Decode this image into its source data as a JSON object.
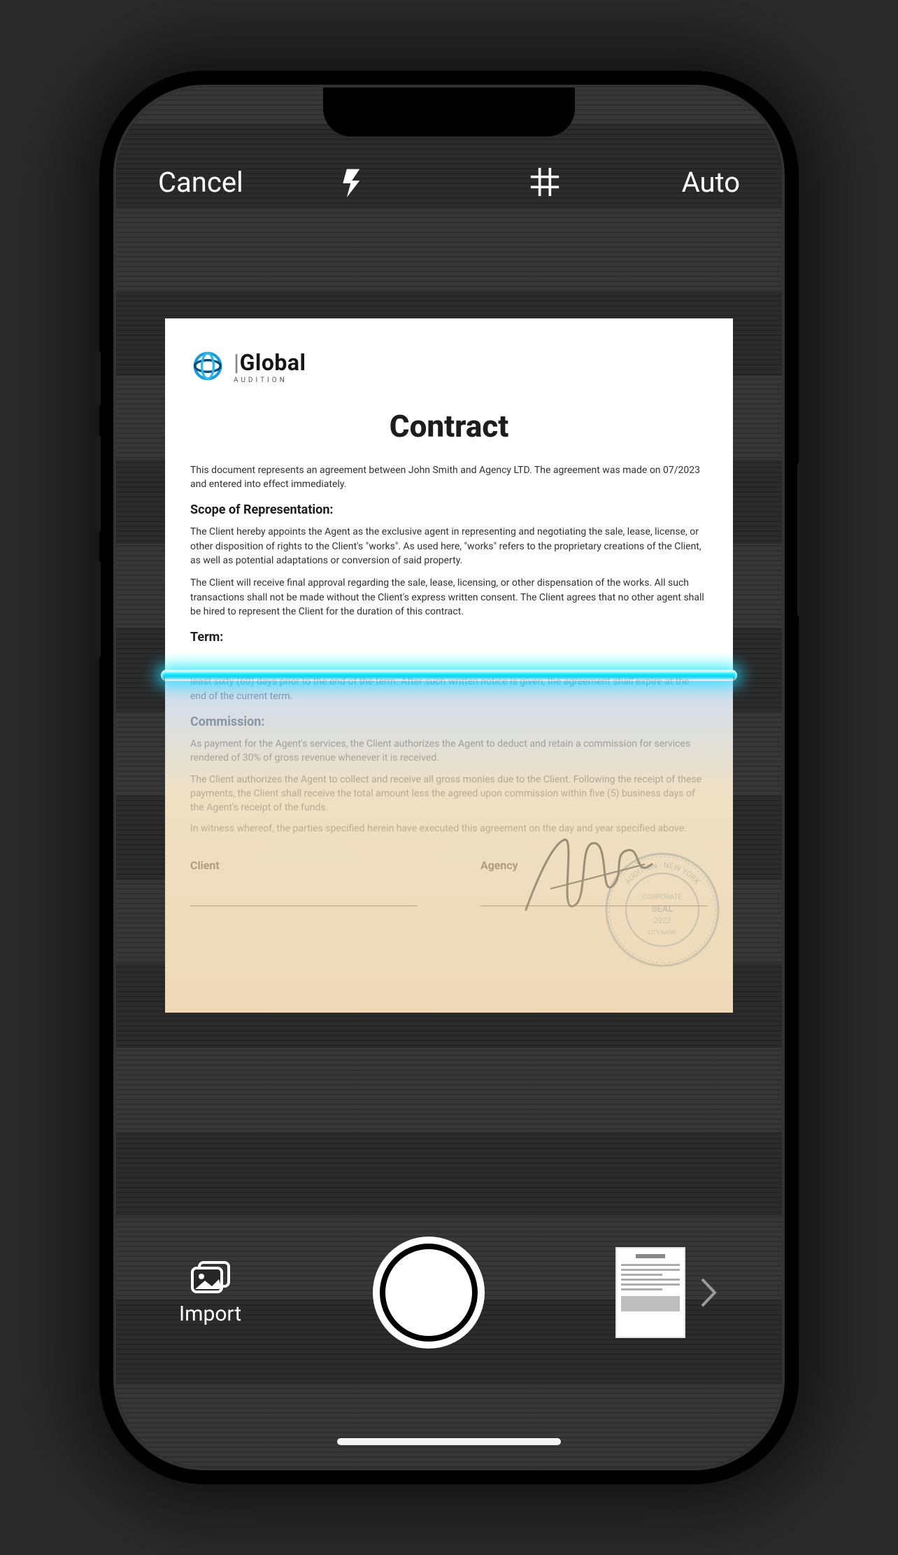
{
  "toolbar": {
    "cancel_label": "Cancel",
    "auto_label": "Auto"
  },
  "bottom": {
    "import_label": "Import"
  },
  "document": {
    "logo_name": "Global",
    "logo_sub": "AUDITION",
    "title": "Contract",
    "intro": "This document represents an agreement between John Smith and Agency LTD. The agreement was made on 07/2023 and entered into effect immediately.",
    "scope_heading": "Scope of Representation:",
    "scope_p1": "The Client hereby appoints the Agent as the exclusive agent in representing and negotiating the sale, lease, license, or other disposition of rights to the Client's \"works\". As used here, \"works\" refers to the proprietary creations of the Client, as well as potential adaptations or conversion of said property.",
    "scope_p2": "The Client will receive final approval regarding the sale, lease, licensing, or other dispensation of the works. All such transactions shall not be made without the Client's express written consent. The Client agrees that no other agent shall be hired to represent the Client for the duration of this contract.",
    "term_heading": "Term:",
    "term_hidden": "least sixty (60) days prior to the end of the term. After such written notice is given, the agreement shall expire at the end of the current term.",
    "commission_heading": "Commission:",
    "commission_p1": "As payment for the Agent's services, the Client authorizes the Agent to deduct and retain a commission for services rendered of 30% of gross revenue whenever it is received.",
    "commission_p2": "The Client authorizes the Agent to collect and receive all gross monies due to the Client. Following the receipt of these payments, the Client shall receive the total amount less the agreed upon commission within five (5) business days of the Agent's receipt of the funds.",
    "witness": "In witness whereof, the parties specified herein have executed this agreement on the day and year specified above.",
    "client_label": "Client",
    "agency_label": "Agency",
    "seal_outer": "AUDITION · NEW YORK",
    "seal_word1": "CORPORATE",
    "seal_word2": "SEAL",
    "seal_year": "2022",
    "seal_city": "CITY NAME"
  }
}
